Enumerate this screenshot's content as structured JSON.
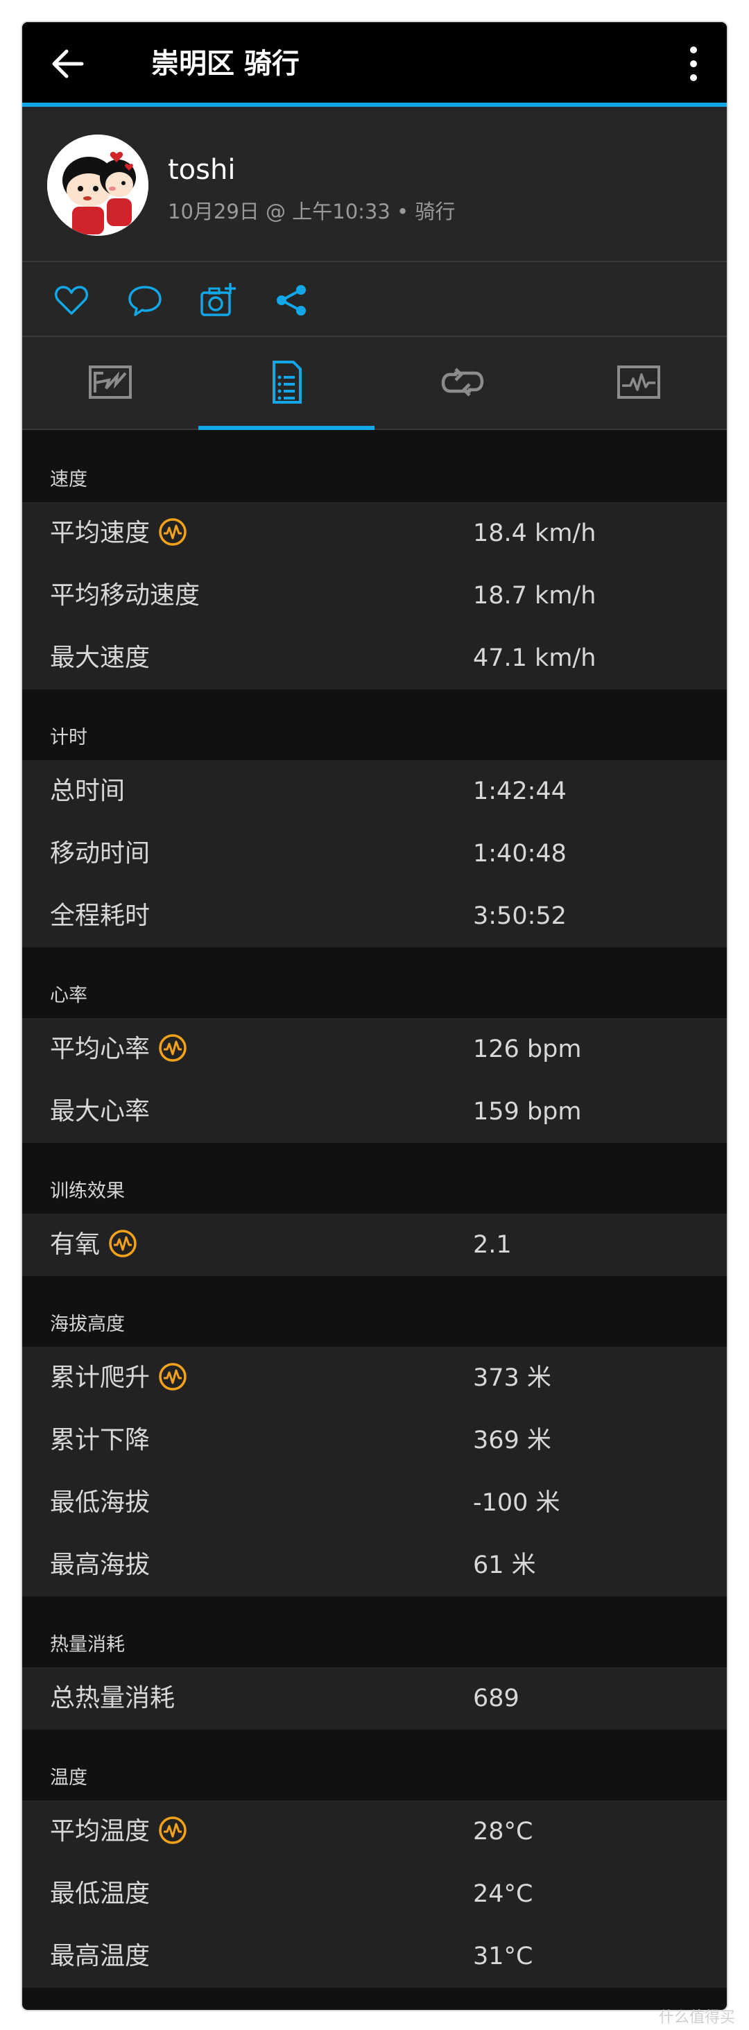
{
  "header": {
    "title": "崇明区 骑行"
  },
  "profile": {
    "name": "toshi",
    "meta": "10月29日 @ 上午10:33 • 骑行"
  },
  "actions": [
    "heart-icon",
    "comment-icon",
    "add-photo-icon",
    "share-icon"
  ],
  "tabs": [
    "map-tab",
    "stats-tab",
    "laps-tab",
    "chart-tab"
  ],
  "colors": {
    "accent": "#12a7e6",
    "badge": "#f5a21b",
    "background": "#111111",
    "row": "#222222"
  },
  "sections": [
    {
      "title": "速度",
      "rows": [
        {
          "label": "平均速度",
          "value": "18.4 km/h",
          "badge": true
        },
        {
          "label": "平均移动速度",
          "value": "18.7 km/h",
          "badge": false
        },
        {
          "label": "最大速度",
          "value": "47.1 km/h",
          "badge": false
        }
      ]
    },
    {
      "title": "计时",
      "rows": [
        {
          "label": "总时间",
          "value": "1:42:44",
          "badge": false
        },
        {
          "label": "移动时间",
          "value": "1:40:48",
          "badge": false
        },
        {
          "label": "全程耗时",
          "value": "3:50:52",
          "badge": false
        }
      ]
    },
    {
      "title": "心率",
      "rows": [
        {
          "label": "平均心率",
          "value": "126 bpm",
          "badge": true
        },
        {
          "label": "最大心率",
          "value": "159 bpm",
          "badge": false
        }
      ]
    },
    {
      "title": "训练效果",
      "rows": [
        {
          "label": "有氧",
          "value": "2.1",
          "badge": true
        }
      ]
    },
    {
      "title": "海拔高度",
      "rows": [
        {
          "label": "累计爬升",
          "value": "373 米",
          "badge": true
        },
        {
          "label": "累计下降",
          "value": "369 米",
          "badge": false
        },
        {
          "label": "最低海拔",
          "value": "-100 米",
          "badge": false
        },
        {
          "label": "最高海拔",
          "value": "61 米",
          "badge": false
        }
      ]
    },
    {
      "title": "热量消耗",
      "rows": [
        {
          "label": "总热量消耗",
          "value": "689",
          "badge": false
        }
      ]
    },
    {
      "title": "温度",
      "rows": [
        {
          "label": "平均温度",
          "value": "28°C",
          "badge": true
        },
        {
          "label": "最低温度",
          "value": "24°C",
          "badge": false
        },
        {
          "label": "最高温度",
          "value": "31°C",
          "badge": false
        }
      ]
    }
  ],
  "watermark": "什么值得买"
}
